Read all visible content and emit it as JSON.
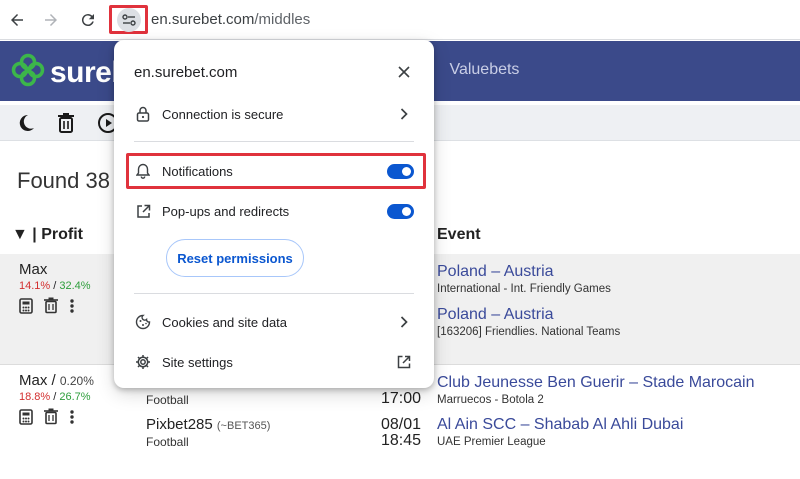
{
  "browser": {
    "url_host": "en.surebet.com",
    "url_path": "/middles"
  },
  "site": {
    "logo_text": "sureb",
    "nav_partial": "s",
    "nav_valuebets": "Valuebets"
  },
  "main": {
    "found_text": "Found 38",
    "col_profit": "▼ | Profit",
    "col_event": "Event"
  },
  "rows": [
    {
      "profit_name": "Max",
      "profit_extra": "",
      "pct_red": "14.1%",
      "pct_sep": " / ",
      "pct_green": "32.4%",
      "events": [
        {
          "title": "Poland – Austria",
          "sub": "International - Int. Friendly Games"
        },
        {
          "title": "Poland – Austria",
          "sub": "[163206] Friendlies. National Teams"
        }
      ]
    },
    {
      "profit_name": "Max / ",
      "profit_extra": "0.20%",
      "pct_red": "18.8%",
      "pct_sep": " / ",
      "pct_green": "26.7%",
      "bets": [
        {
          "book": "",
          "book_note": "",
          "sport": "Football",
          "date": "",
          "time": "17:00",
          "event": "Club Jeunesse Ben Guerir – Stade Marocain",
          "event_sub": "Marruecos - Botola 2"
        },
        {
          "book": "Pixbet285",
          "book_note": "(~BET365)",
          "sport": "Football",
          "date": "08/01",
          "time": "18:45",
          "event": "Al Ain SCC – Shabab Al Ahli Dubai",
          "event_sub": "UAE Premier League"
        }
      ]
    }
  ],
  "popup": {
    "title": "en.surebet.com",
    "connection": "Connection is secure",
    "notifications": "Notifications",
    "notifications_on": true,
    "popups": "Pop-ups and redirects",
    "popups_on": true,
    "reset": "Reset permissions",
    "cookies": "Cookies and site data",
    "site_settings": "Site settings"
  },
  "colors": {
    "header": "#3b4a8a",
    "link": "#3a4a9a",
    "toggle": "#0b57d0",
    "highlight": "#e0323c",
    "logo_green": "#3cb64a"
  },
  "icons": [
    "back-arrow-icon",
    "forward-arrow-icon",
    "reload-icon",
    "site-info-icon",
    "close-icon",
    "lock-icon",
    "bell-icon",
    "popup-open-icon",
    "cookie-icon",
    "gear-icon",
    "external-link-icon",
    "chevron-right-icon",
    "moon-icon",
    "trash-icon",
    "play-icon",
    "calculator-icon",
    "more-vert-icon",
    "clover-logo-icon"
  ]
}
